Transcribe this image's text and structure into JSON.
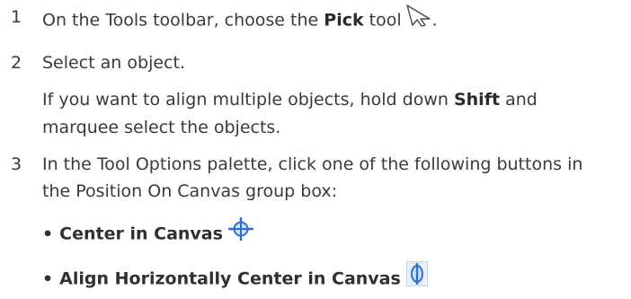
{
  "steps": [
    {
      "num": "1",
      "pre": "On the Tools toolbar, choose the ",
      "bold": "Pick",
      "post": " tool",
      "end": ".",
      "icon": "pick-tool-icon"
    },
    {
      "num": "2",
      "line": "Select an object.",
      "sub_pre": "If you want to align multiple objects, hold down ",
      "sub_bold": "Shift",
      "sub_post": " and",
      "sub_line2": "marquee select the objects."
    },
    {
      "num": "3",
      "line1": "In the Tool Options palette, click one of the following buttons in",
      "line2": "the Position On Canvas group box:"
    }
  ],
  "options": [
    {
      "bullet": "•",
      "label": "Center in Canvas",
      "icon": "center-in-canvas-icon"
    },
    {
      "bullet": "•",
      "label": "Align Horizontally Center in Canvas",
      "icon": "align-horizontal-center-icon"
    }
  ],
  "colors": {
    "text": "#3a3a3a",
    "icon_blue": "#2a6fd6",
    "icon_bg": "#dceaf8"
  }
}
